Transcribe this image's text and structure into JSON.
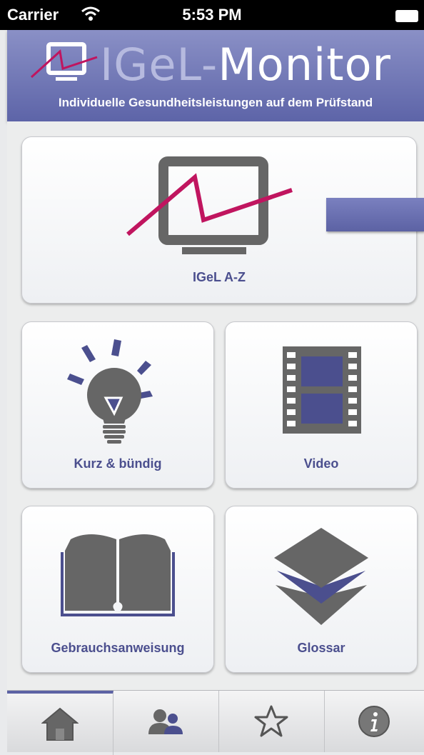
{
  "status_bar": {
    "carrier": "Carrier",
    "time": "5:53 PM"
  },
  "header": {
    "brand_light": "IGeL-",
    "brand_strong": "Monitor",
    "tagline": "Individuelle Gesundheitsleistungen auf dem Prüfstand"
  },
  "tiles": {
    "igel_az": "IGeL A-Z",
    "kurz": "Kurz & bündig",
    "video": "Video",
    "gebrauch": "Gebrauchsanweisung",
    "glossar": "Glossar"
  },
  "tabbar": {
    "active_tab": "home",
    "tabs": [
      "home-icon",
      "people-icon",
      "star-icon",
      "info-icon"
    ]
  },
  "colors": {
    "accent": "#5c62a4",
    "label": "#4b4f8e",
    "chart_line": "#c0155f",
    "icon_gray": "#666666"
  }
}
